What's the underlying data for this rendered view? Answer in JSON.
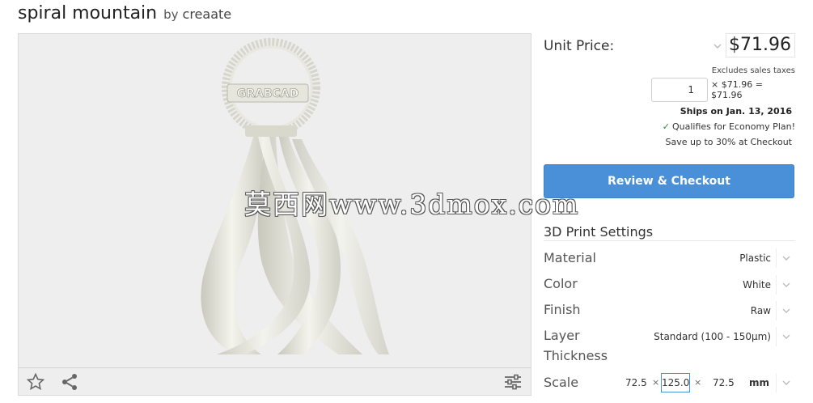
{
  "product": {
    "title": "spiral mountain",
    "by": "by",
    "author": "creaate"
  },
  "viewer": {
    "model_label": "GRABCAD",
    "watermark": "莫西网www.3dmox.com"
  },
  "pricing": {
    "unit_price_label": "Unit Price:",
    "price": "$71.96",
    "excludes": "Excludes sales taxes",
    "quantity": "1",
    "calc": "× $71.96 = $71.96",
    "ships": "Ships on Jan. 13, 2016",
    "qualifies": "Qualifies for Economy Plan!",
    "save_up": "Save up to 30% at Checkout"
  },
  "checkout": {
    "label": "Review & Checkout"
  },
  "settings": {
    "title": "3D Print Settings",
    "material": {
      "label": "Material",
      "value": "Plastic"
    },
    "color": {
      "label": "Color",
      "value": "White"
    },
    "finish": {
      "label": "Finish",
      "value": "Raw"
    },
    "layer": {
      "label_1": "Layer",
      "label_2": "Thickness",
      "value": "Standard (100 - 150µm)"
    },
    "scale": {
      "label": "Scale",
      "x": "72.5",
      "y": "125.0",
      "z": "72.5",
      "times": "×",
      "unit": "mm"
    }
  },
  "icons": [
    "star-icon",
    "share-icon",
    "sliders-icon",
    "chevron-down-icon",
    "check-icon"
  ],
  "colors": {
    "accent": "#4a90d9",
    "check_green": "#2e8b2e",
    "viewer_bg": "#eeeeee"
  }
}
